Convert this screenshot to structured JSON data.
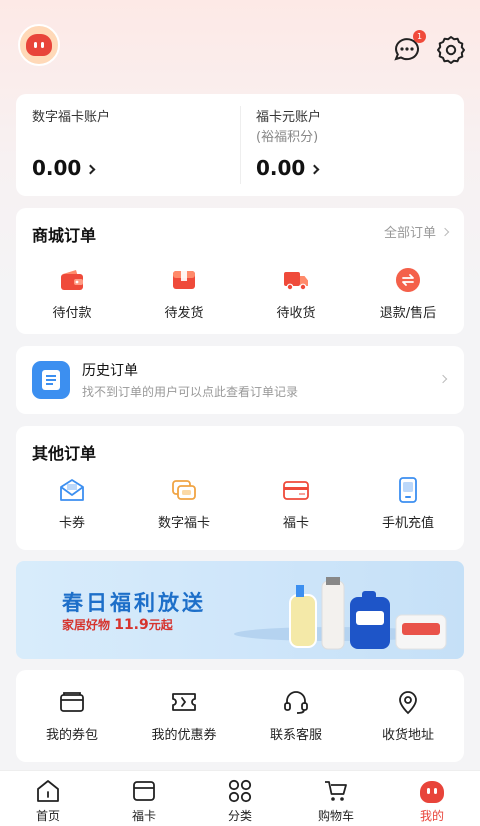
{
  "header": {
    "message_badge": "1"
  },
  "accounts": [
    {
      "title": "数字福卡账户",
      "subtitle": "",
      "amount": "0.00"
    },
    {
      "title": "福卡元账户",
      "subtitle": "(裕福积分)",
      "amount": "0.00"
    }
  ],
  "mall_orders": {
    "title": "商城订单",
    "more": "全部订单",
    "items": [
      {
        "label": "待付款",
        "icon": "wallet-icon"
      },
      {
        "label": "待发货",
        "icon": "box-icon"
      },
      {
        "label": "待收货",
        "icon": "truck-icon"
      },
      {
        "label": "退款/售后",
        "icon": "refund-icon"
      }
    ]
  },
  "history": {
    "title": "历史订单",
    "subtitle": "找不到订单的用户可以点此查看订单记录"
  },
  "other_orders": {
    "title": "其他订单",
    "items": [
      {
        "label": "卡券",
        "icon": "envelope-icon"
      },
      {
        "label": "数字福卡",
        "icon": "cards-icon"
      },
      {
        "label": "福卡",
        "icon": "card-icon"
      },
      {
        "label": "手机充值",
        "icon": "phone-icon"
      }
    ]
  },
  "banner": {
    "title": "春日福利放送",
    "subtitle_prefix": "家居好物",
    "subtitle_price": "11.9",
    "subtitle_suffix": "元起"
  },
  "tools": {
    "items": [
      {
        "label": "我的券包",
        "icon": "wallet-outline-icon"
      },
      {
        "label": "我的优惠券",
        "icon": "ticket-icon"
      },
      {
        "label": "联系客服",
        "icon": "headset-icon"
      },
      {
        "label": "收货地址",
        "icon": "location-icon"
      }
    ]
  },
  "tabbar": {
    "items": [
      {
        "label": "首页"
      },
      {
        "label": "福卡"
      },
      {
        "label": "分类"
      },
      {
        "label": "购物车"
      },
      {
        "label": "我的"
      }
    ]
  },
  "colors": {
    "accent": "#e8443a",
    "blue": "#3c8ff0",
    "orange": "#f0a444"
  }
}
